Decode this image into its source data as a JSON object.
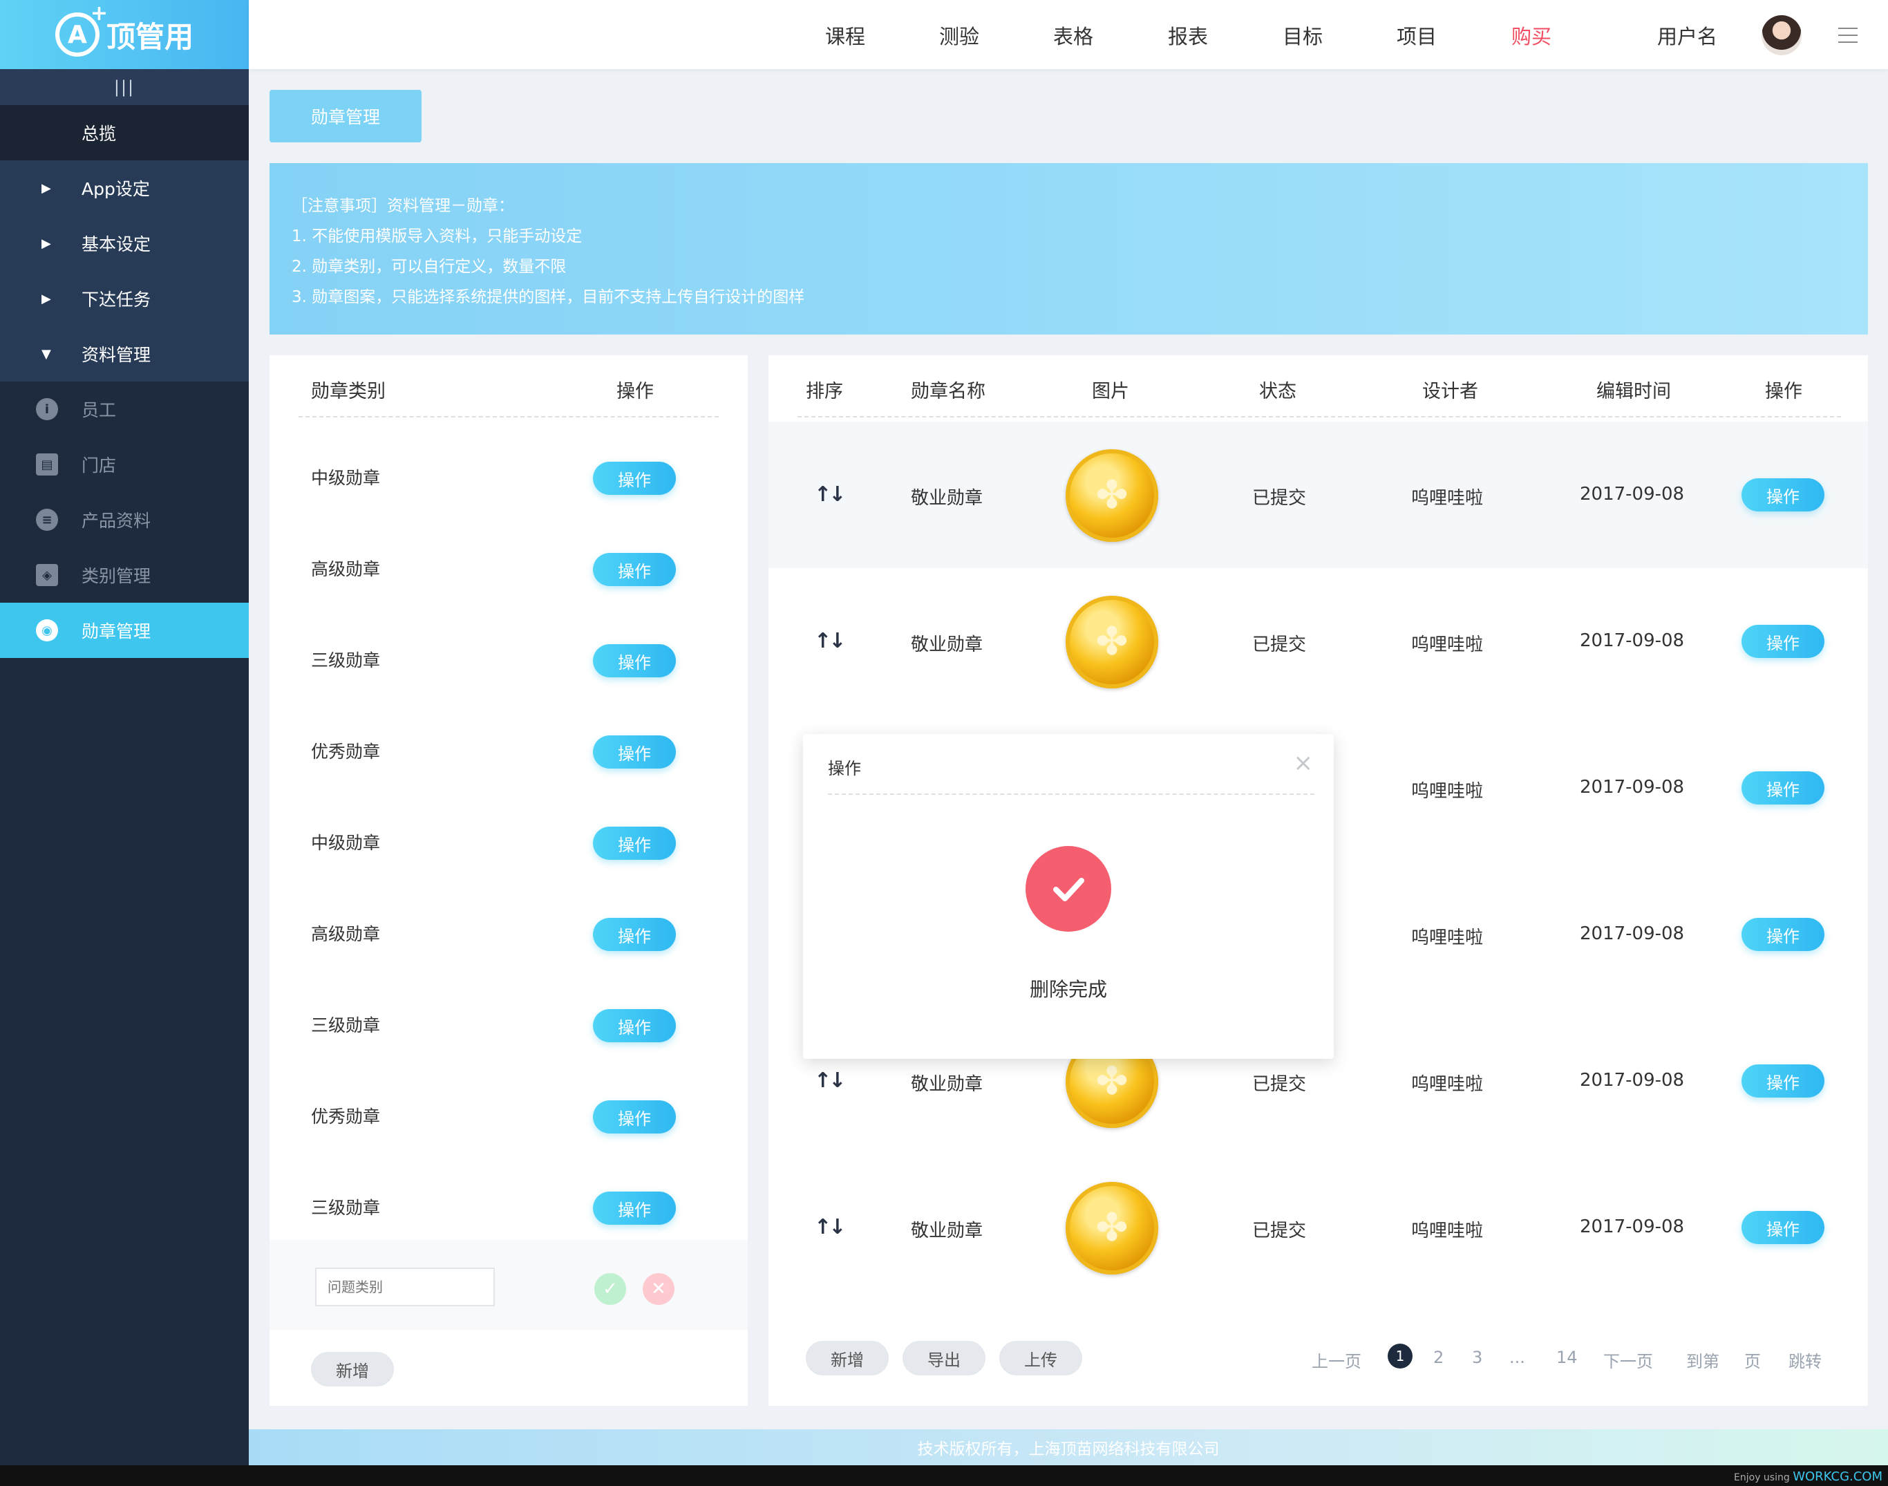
{
  "brand": {
    "logo_text": "顶管用",
    "logo_mark": "A"
  },
  "sidebar": {
    "collapse_label": "|||",
    "items": [
      {
        "label": "总揽"
      },
      {
        "label": "App设定"
      },
      {
        "label": "基本设定"
      },
      {
        "label": "下达任务"
      },
      {
        "label": "资料管理"
      },
      {
        "label": "员工"
      },
      {
        "label": "门店"
      },
      {
        "label": "产品资料"
      },
      {
        "label": "类别管理"
      },
      {
        "label": "勋章管理"
      }
    ]
  },
  "topnav": {
    "links": [
      "课程",
      "测验",
      "表格",
      "报表",
      "目标",
      "项目",
      "购买"
    ],
    "username": "用户名"
  },
  "page_tab": "勋章管理",
  "notice": {
    "lines": [
      "［注意事项］资料管理－勋章：",
      "1. 不能使用模版导入资料，只能手动设定",
      "2. 勋章类别，可以自行定义，数量不限",
      "3. 勋章图案，只能选择系统提供的图样，目前不支持上传自行设计的图样"
    ]
  },
  "categories": {
    "headers": [
      "勋章类别",
      "操作"
    ],
    "rows": [
      {
        "name": "中级勋章",
        "action": "操作"
      },
      {
        "name": "高级勋章",
        "action": "操作"
      },
      {
        "name": "三级勋章",
        "action": "操作"
      },
      {
        "name": "优秀勋章",
        "action": "操作"
      },
      {
        "name": "中级勋章",
        "action": "操作"
      },
      {
        "name": "高级勋章",
        "action": "操作"
      },
      {
        "name": "三级勋章",
        "action": "操作"
      },
      {
        "name": "优秀勋章",
        "action": "操作"
      },
      {
        "name": "三级勋章",
        "action": "操作"
      }
    ],
    "input_placeholder": "问题类别",
    "add_label": "新增"
  },
  "medals": {
    "headers": [
      "排序",
      "勋章名称",
      "图片",
      "状态",
      "设计者",
      "编辑时间",
      "操作"
    ],
    "rows": [
      {
        "name": "敬业勋章",
        "status": "已提交",
        "designer": "呜哩哇啦",
        "time": "2017-09-08",
        "action": "操作"
      },
      {
        "name": "敬业勋章",
        "status": "已提交",
        "designer": "呜哩哇啦",
        "time": "2017-09-08",
        "action": "操作"
      },
      {
        "name": "",
        "status": "",
        "designer": "呜哩哇啦",
        "time": "2017-09-08",
        "action": "操作"
      },
      {
        "name": "",
        "status": "",
        "designer": "呜哩哇啦",
        "time": "2017-09-08",
        "action": "操作"
      },
      {
        "name": "敬业勋章",
        "status": "已提交",
        "designer": "呜哩哇啦",
        "time": "2017-09-08",
        "action": "操作"
      },
      {
        "name": "敬业勋章",
        "status": "已提交",
        "designer": "呜哩哇啦",
        "time": "2017-09-08",
        "action": "操作"
      }
    ],
    "buttons": [
      "新增",
      "导出",
      "上传"
    ]
  },
  "pager": {
    "prev": "上一页",
    "current": "1",
    "pages": [
      "2",
      "3",
      "...",
      "14"
    ],
    "next": "下一页",
    "goto": "到第",
    "page_unit": "页",
    "jump": "跳转"
  },
  "modal": {
    "title": "操作",
    "close": "×",
    "message": "删除完成"
  },
  "footer": "技术版权所有，上海顶苗网络科技有限公司",
  "credit": {
    "prefix": "Enjoy using",
    "site": "WORKCG.COM"
  },
  "colors": {
    "accent": "#3ec6ee",
    "sidebar": "#1e2a3d",
    "hot": "#f24e63",
    "success": "#f45e6e"
  }
}
